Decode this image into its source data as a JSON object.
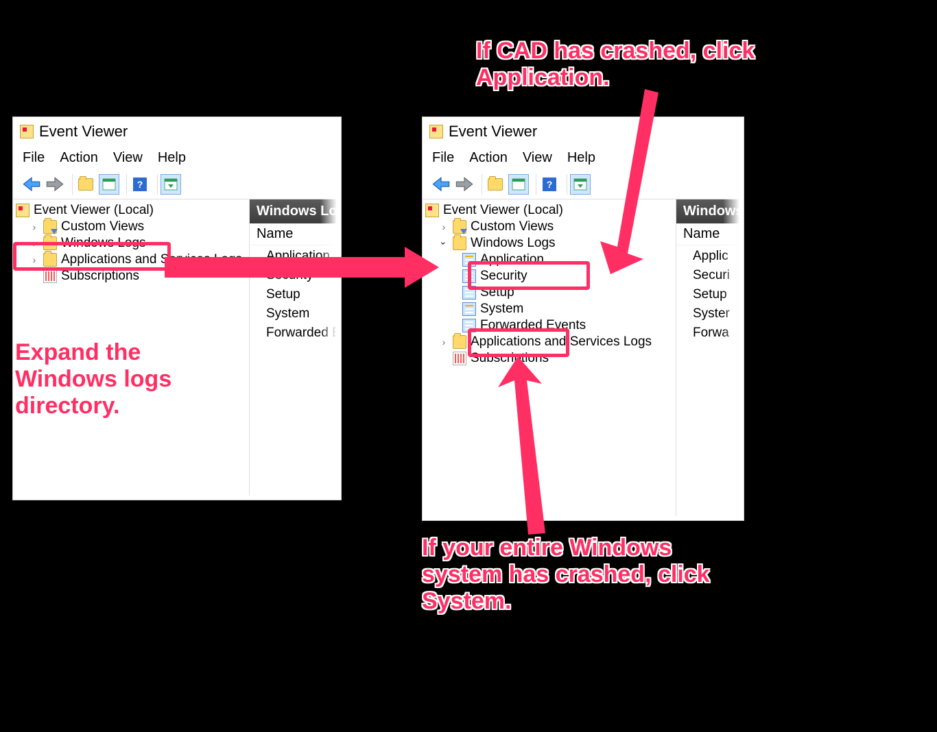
{
  "app_title": "Event Viewer",
  "menu": {
    "file": "File",
    "action": "Action",
    "view": "View",
    "help": "Help"
  },
  "tree": {
    "root": "Event Viewer (Local)",
    "custom_views": "Custom Views",
    "windows_logs": "Windows Logs",
    "apps_services": "Applications and Services Logs",
    "subscriptions": "Subscriptions",
    "logs": {
      "application": "Application",
      "security": "Security",
      "setup": "Setup",
      "system": "System",
      "forwarded": "Forwarded Events"
    }
  },
  "list": {
    "header": "Windows Logs",
    "header_short": "Windows L",
    "col_name": "Name",
    "items": [
      "Application",
      "Security",
      "Setup",
      "System",
      "Forwarded Events"
    ],
    "items_short": [
      "Applic",
      "Securi",
      "Setup",
      "Syster",
      "Forwa"
    ]
  },
  "annotations": {
    "expand": "Expand the Windows logs directory.",
    "cad": "If CAD has crashed, click Application.",
    "system": "If your entire Windows system has crashed, click System."
  },
  "colors": {
    "annotation": "#ff2e63"
  }
}
